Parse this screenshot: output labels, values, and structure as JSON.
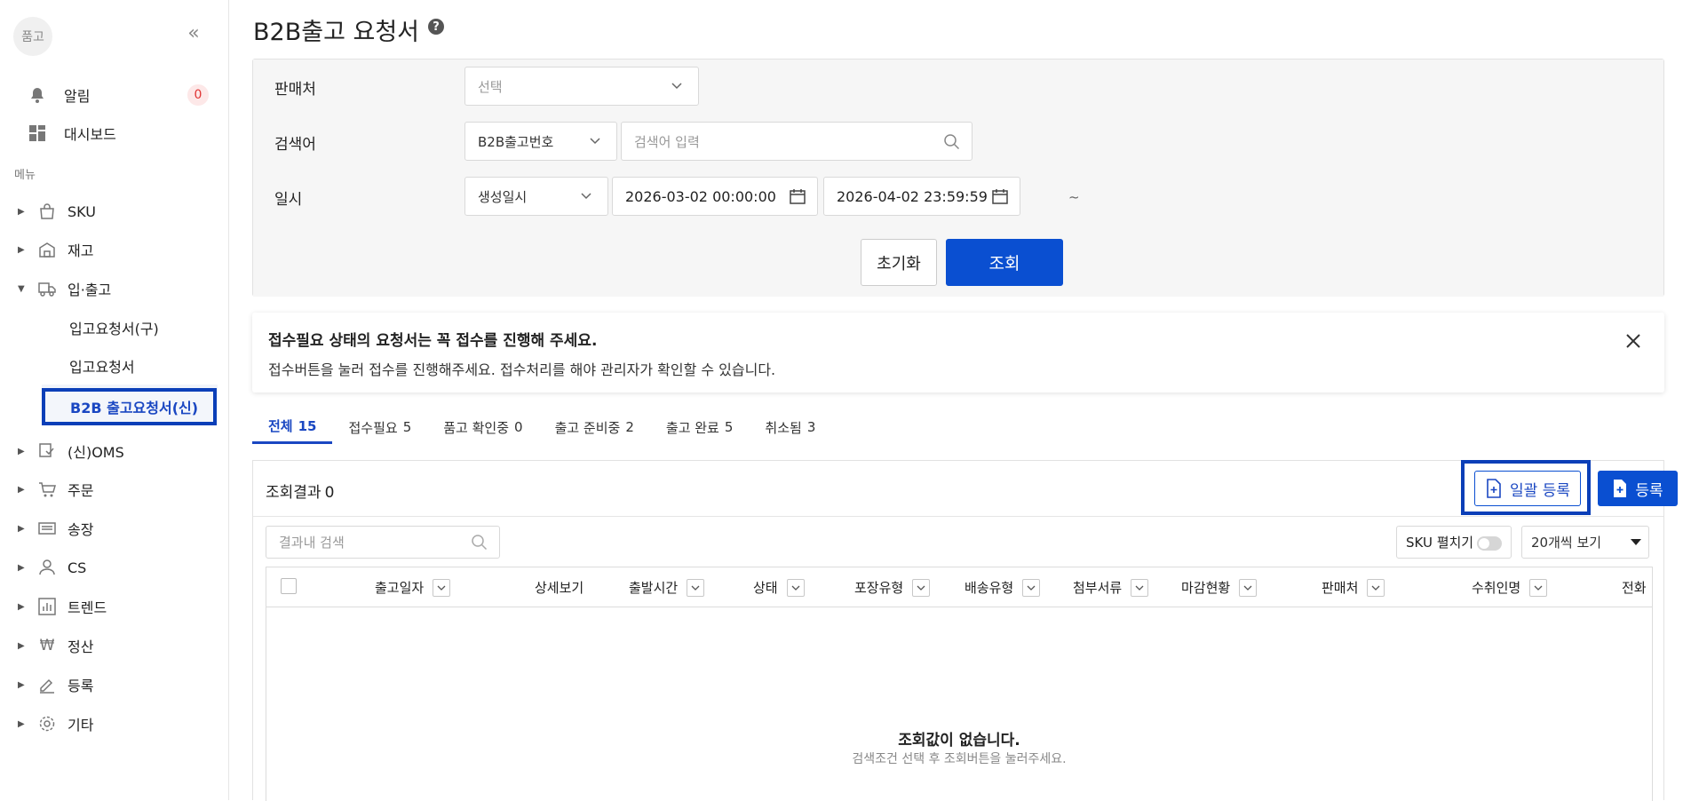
{
  "sidebar": {
    "avatar": "품고",
    "top_items": [
      {
        "label": "알림",
        "icon": "bell-icon",
        "badge": "0"
      },
      {
        "label": "대시보드",
        "icon": "dashboard-icon"
      }
    ],
    "menu_label": "메뉴",
    "menu": [
      {
        "label": "SKU",
        "icon": "bag-icon"
      },
      {
        "label": "재고",
        "icon": "warehouse-icon"
      },
      {
        "label": "입·출고",
        "icon": "truck-icon",
        "expanded": true,
        "children": [
          "입고요청서(구)",
          "입고요청서",
          "B2B 출고요청서(신)"
        ]
      },
      {
        "label": "(신)OMS",
        "icon": "oms-icon"
      },
      {
        "label": "주문",
        "icon": "cart-icon"
      },
      {
        "label": "송장",
        "icon": "invoice-icon"
      },
      {
        "label": "CS",
        "icon": "user-icon"
      },
      {
        "label": "트렌드",
        "icon": "chart-icon"
      },
      {
        "label": "정산",
        "icon": "won-icon"
      },
      {
        "label": "등록",
        "icon": "pen-icon"
      },
      {
        "label": "기타",
        "icon": "gear-icon"
      }
    ]
  },
  "page": {
    "title": "B2B출고 요청서",
    "help": "?"
  },
  "filter": {
    "seller_label": "판매처",
    "seller_placeholder": "선택",
    "keyword_label": "검색어",
    "keyword_type": "B2B출고번호",
    "keyword_placeholder": "검색어 입력",
    "date_label": "일시",
    "date_type": "생성일시",
    "date_from": "2026-03-02 00:00:00",
    "date_sep": "~",
    "date_to": "2026-04-02 23:59:59",
    "reset_label": "초기화",
    "search_label": "조회"
  },
  "notice": {
    "title": "접수필요 상태의 요청서는 꼭 접수를 진행해 주세요.",
    "body": "접수버튼을 눌러 접수를 진행해주세요. 접수처리를 해야 관리자가 확인할 수 있습니다."
  },
  "tabs": [
    {
      "label": "전체",
      "count": "15",
      "active": true
    },
    {
      "label": "접수필요",
      "count": "5"
    },
    {
      "label": "품고 확인중",
      "count": "0"
    },
    {
      "label": "출고 준비중",
      "count": "2"
    },
    {
      "label": "출고 완료",
      "count": "5"
    },
    {
      "label": "취소됨",
      "count": "3"
    }
  ],
  "result": {
    "count_label": "조회결과",
    "count": "0",
    "bulk_label": "일괄 등록",
    "register_label": "등록",
    "search_placeholder": "결과내 검색",
    "sku_toggle_label": "SKU 펼치기",
    "page_size": "20개씩 보기",
    "columns": [
      "출고일자",
      "상세보기",
      "출발시간",
      "상태",
      "포장유형",
      "배송유형",
      "첨부서류",
      "마감현황",
      "판매처",
      "수취인명",
      "전화"
    ],
    "empty_title": "조회값이 없습니다.",
    "empty_sub": "검색조건 선택 후 조회버튼을 눌러주세요."
  }
}
